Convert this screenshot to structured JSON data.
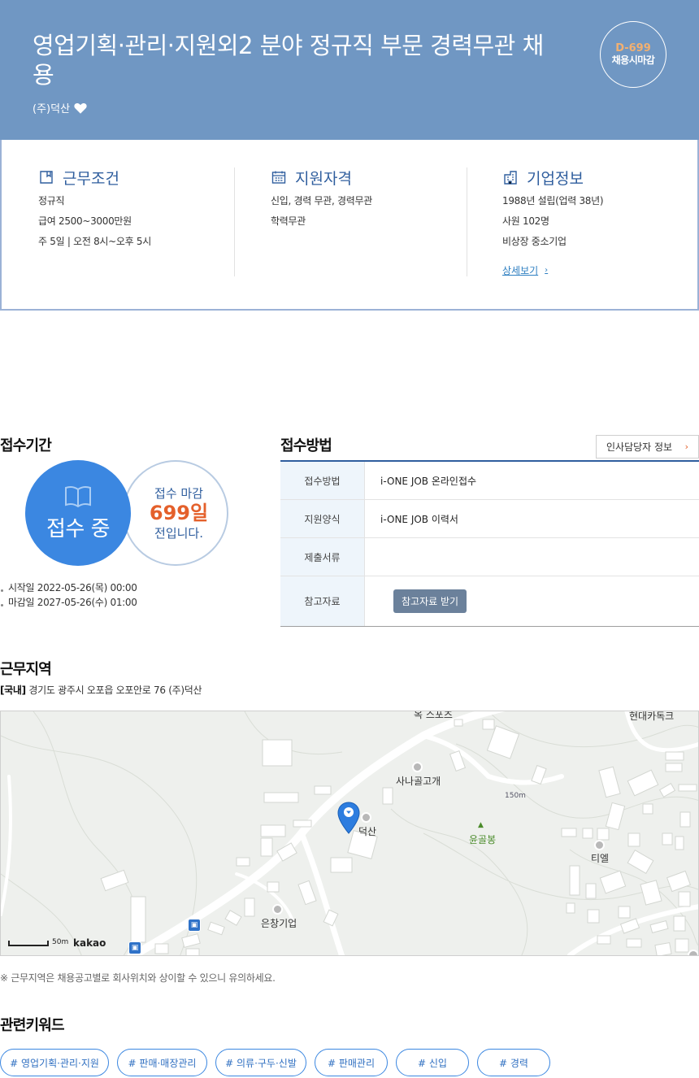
{
  "header": {
    "title": "영업기획·관리·지원외2 분야 정규직 부문 경력무관 채용",
    "company": "(주)덕산",
    "dday": "D-699",
    "dday_label": "채용시마감",
    "colors": {
      "background": "#7097c3",
      "dday_number": "#f2b071"
    }
  },
  "summary": {
    "work_conditions": {
      "title": "근무조건",
      "lines": [
        "정규직",
        "급여 2500~3000만원",
        "주 5일 | 오전 8시~오후 5시"
      ]
    },
    "qualifications": {
      "title": "지원자격",
      "lines": [
        "신입, 경력 무관, 경력무관",
        "학력무관"
      ]
    },
    "company_info": {
      "title": "기업정보",
      "lines": [
        "1988년 설립(업력 38년)",
        "사원 102명",
        "비상장 중소기업"
      ],
      "more_link": "상세보기"
    }
  },
  "period": {
    "title": "접수기간",
    "status": "접수 중",
    "deadline_line1": "접수 마감",
    "deadline_days": "699일",
    "deadline_line3": "전입니다.",
    "start": "시작일 2022-05-26(목) 00:00",
    "end": "마감일 2027-05-26(수) 01:00"
  },
  "apply": {
    "title": "접수방법",
    "contact_button": "인사담당자 정보",
    "rows": [
      {
        "label": "접수방법",
        "value": "i-ONE JOB 온라인접수"
      },
      {
        "label": "지원양식",
        "value": "i-ONE JOB 이력서"
      },
      {
        "label": "제출서류",
        "value": ""
      },
      {
        "label": "참고자료",
        "button": "참고자료 받기"
      }
    ]
  },
  "location": {
    "title": "근무지역",
    "region_tag": "[국내]",
    "address": "경기도 광주시 오포읍 오포안로 76 (주)덕산",
    "map_labels": {
      "top_partial": "옥 스포츠",
      "top_right": "현대카독크",
      "pass": "사나골고개",
      "elevation": "150m",
      "peak": "윤골봉",
      "company": "덕산",
      "tiel": "티엘",
      "eunchang": "은창기업"
    },
    "scale": "50m",
    "map_brand": "kakao",
    "note": "※ 근무지역은 채용공고별로 회사위치와 상이할 수 있으니 유의하세요."
  },
  "keywords": {
    "title": "관련키워드",
    "items": [
      "# 영업기획·관리·지원",
      "# 판매·매장관리",
      "# 의류·구두·신발",
      "# 판매관리",
      "# 신입",
      "# 경력"
    ]
  }
}
